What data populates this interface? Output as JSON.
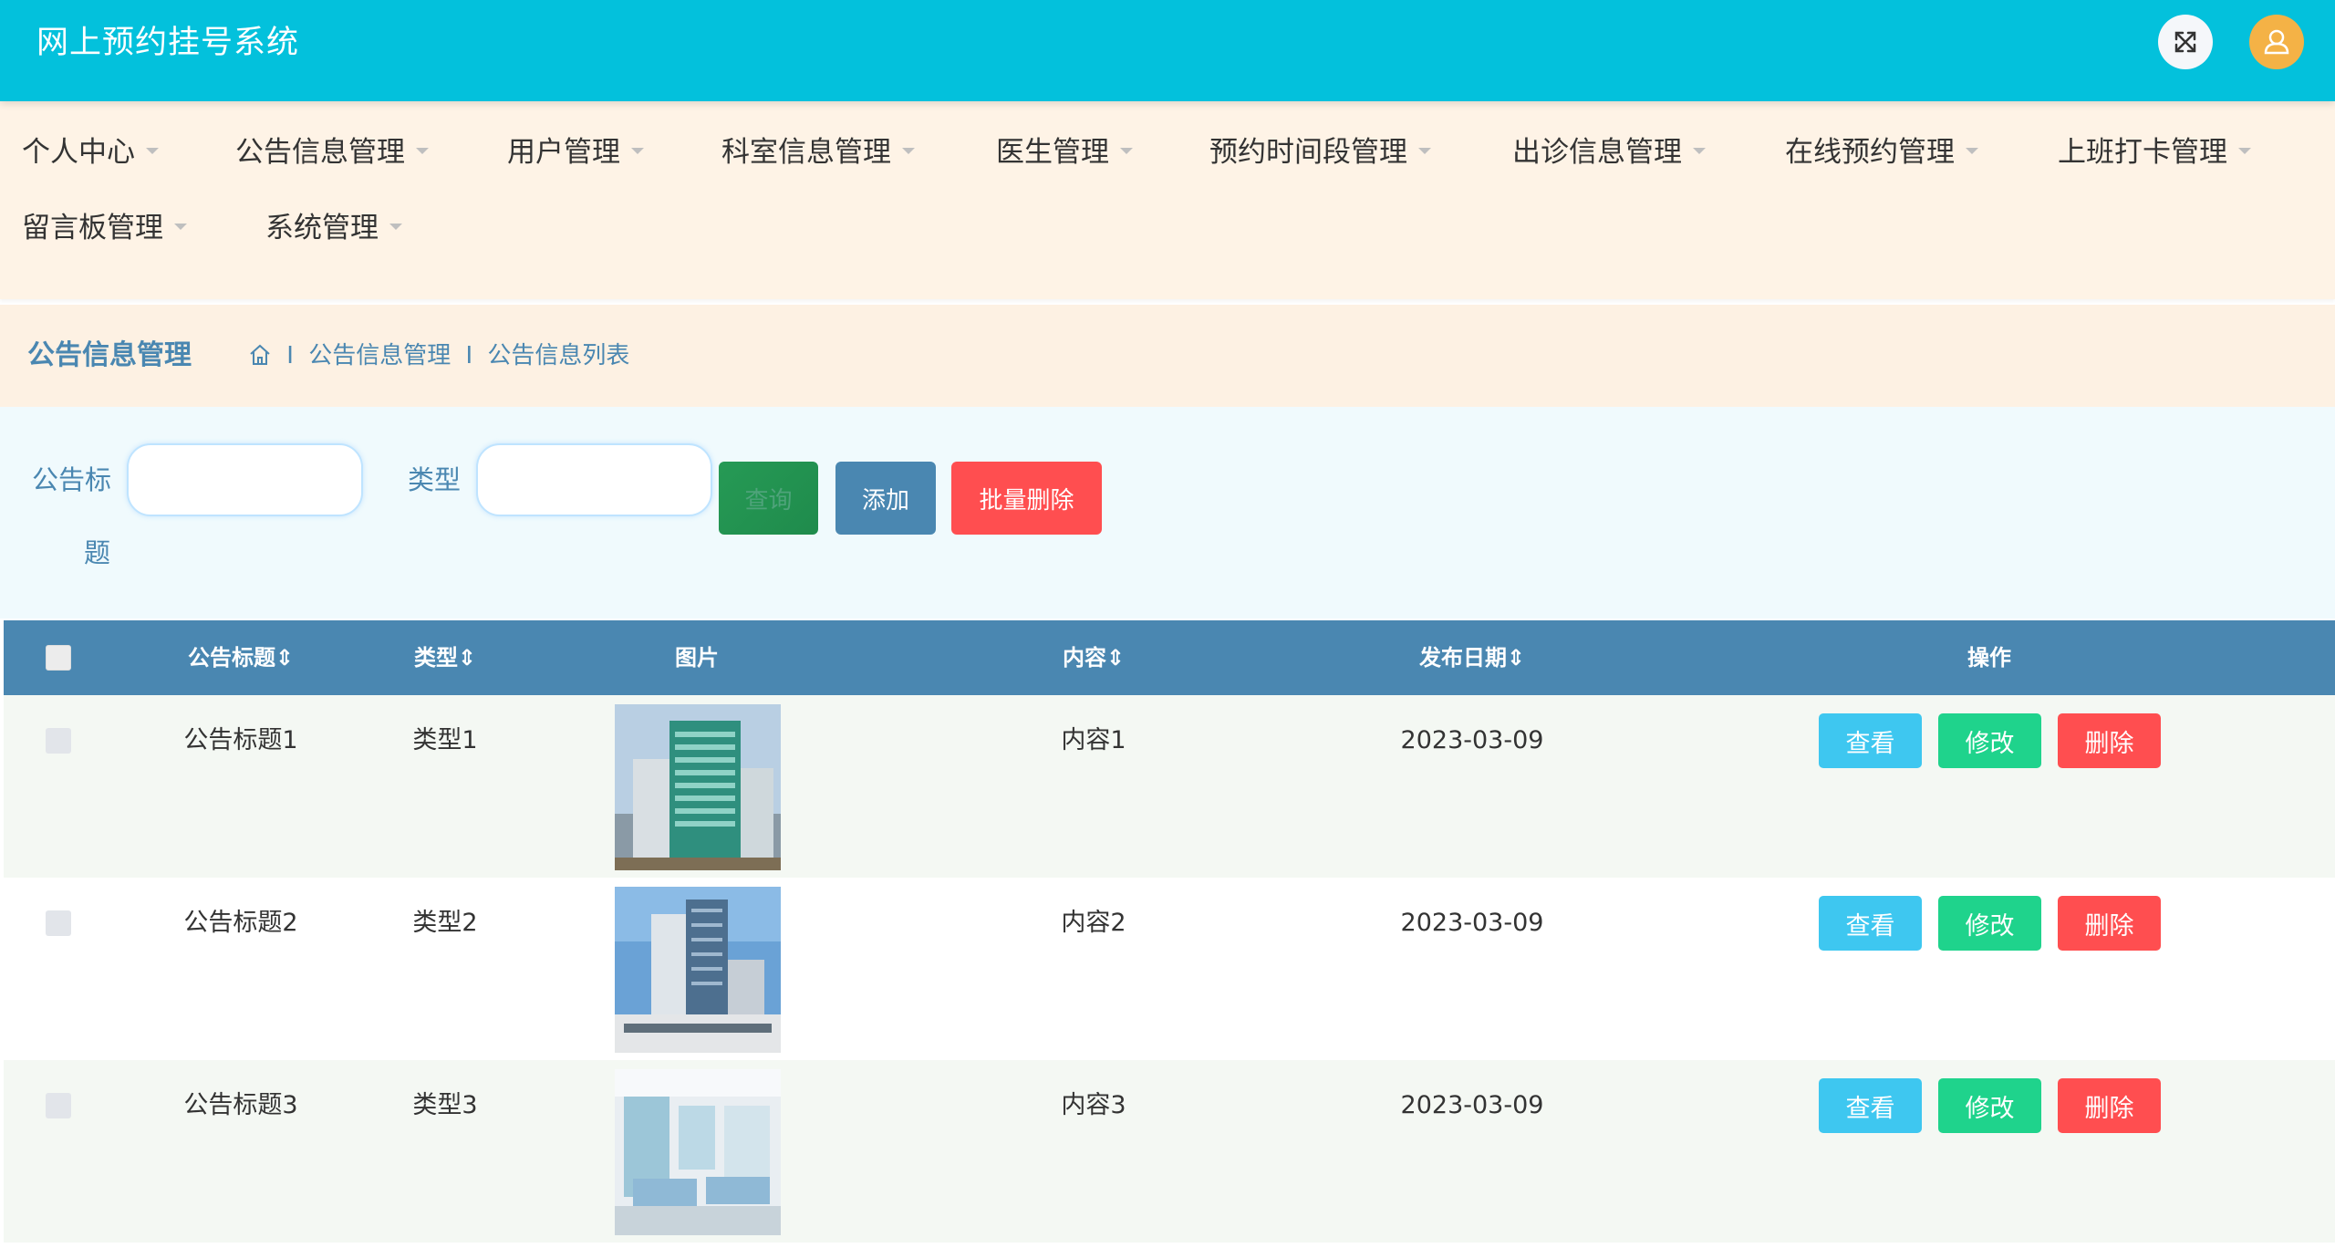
{
  "header": {
    "title": "网上预约挂号系统",
    "fullscreen_icon": "expand-icon",
    "user_icon": "user-icon"
  },
  "nav": {
    "items": [
      {
        "label": "个人中心"
      },
      {
        "label": "公告信息管理"
      },
      {
        "label": "用户管理"
      },
      {
        "label": "科室信息管理"
      },
      {
        "label": "医生管理"
      },
      {
        "label": "预约时间段管理"
      },
      {
        "label": "出诊信息管理"
      },
      {
        "label": "在线预约管理"
      },
      {
        "label": "上班打卡管理"
      },
      {
        "label": "留言板管理"
      },
      {
        "label": "系统管理"
      }
    ]
  },
  "breadcrumb": {
    "title": "公告信息管理",
    "sep": "I",
    "level1": "公告信息管理",
    "level2": "公告信息列表"
  },
  "search": {
    "title_label_line1": "公告标",
    "title_label_line2": "题",
    "title_value": "",
    "type_label": "类型",
    "type_value": "",
    "query_button": "查询",
    "add_button": "添加",
    "batch_delete_button": "批量删除"
  },
  "table": {
    "headers": {
      "title": "公告标题",
      "type": "类型",
      "image": "图片",
      "content": "内容",
      "date": "发布日期",
      "actions": "操作"
    },
    "rows": [
      {
        "title": "公告标题1",
        "type": "类型1",
        "content": "内容1",
        "date": "2023-03-09"
      },
      {
        "title": "公告标题2",
        "type": "类型2",
        "content": "内容2",
        "date": "2023-03-09"
      },
      {
        "title": "公告标题3",
        "type": "类型3",
        "content": "内容3",
        "date": "2023-03-09"
      }
    ],
    "actions": {
      "view": "查看",
      "edit": "修改",
      "delete": "删除"
    }
  },
  "colors": {
    "header_bg": "#03c1dc",
    "nav_bg": "#fef3e6",
    "table_head_bg": "#4a87b1",
    "view_btn": "#3ec7f0",
    "edit_btn": "#1fd38c",
    "delete_btn": "#ff4e50"
  }
}
